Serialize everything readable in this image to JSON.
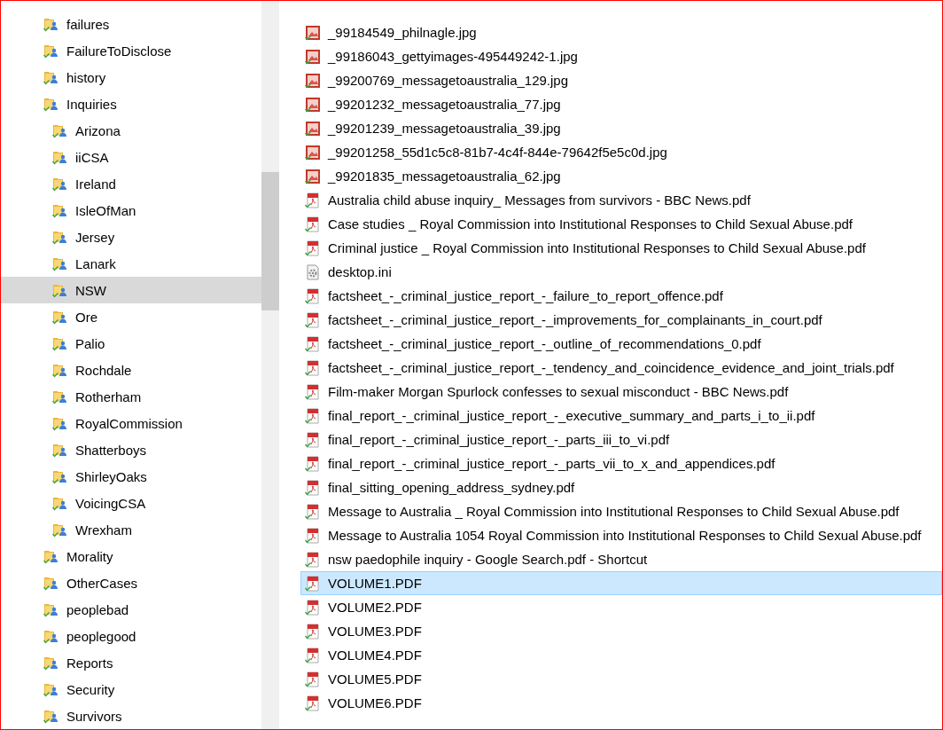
{
  "navigation_tree": {
    "items": [
      {
        "label": "failures",
        "selected": false
      },
      {
        "label": "FailureToDisclose",
        "selected": false
      },
      {
        "label": "history",
        "selected": false
      },
      {
        "label": "Inquiries",
        "selected": false,
        "children": [
          {
            "label": "Arizona",
            "selected": false
          },
          {
            "label": "iiCSA",
            "selected": false
          },
          {
            "label": "Ireland",
            "selected": false
          },
          {
            "label": "IsleOfMan",
            "selected": false
          },
          {
            "label": "Jersey",
            "selected": false
          },
          {
            "label": "Lanark",
            "selected": false
          },
          {
            "label": "NSW",
            "selected": true
          },
          {
            "label": "Ore",
            "selected": false
          },
          {
            "label": "Palio",
            "selected": false
          },
          {
            "label": "Rochdale",
            "selected": false
          },
          {
            "label": "Rotherham",
            "selected": false
          },
          {
            "label": "RoyalCommission",
            "selected": false
          },
          {
            "label": "Shatterboys",
            "selected": false
          },
          {
            "label": "ShirleyOaks",
            "selected": false
          },
          {
            "label": "VoicingCSA",
            "selected": false
          },
          {
            "label": "Wrexham",
            "selected": false
          }
        ]
      },
      {
        "label": "Morality",
        "selected": false
      },
      {
        "label": "OtherCases",
        "selected": false
      },
      {
        "label": "peoplebad",
        "selected": false
      },
      {
        "label": "peoplegood",
        "selected": false
      },
      {
        "label": "Reports",
        "selected": false
      },
      {
        "label": "Security",
        "selected": false
      },
      {
        "label": "Survivors",
        "selected": false
      }
    ]
  },
  "file_list": {
    "files": [
      {
        "name": "_99184549_philnagle.jpg",
        "kind": "image",
        "selected": false
      },
      {
        "name": "_99186043_gettyimages-495449242-1.jpg",
        "kind": "image",
        "selected": false
      },
      {
        "name": "_99200769_messagetoaustralia_129.jpg",
        "kind": "image",
        "selected": false
      },
      {
        "name": "_99201232_messagetoaustralia_77.jpg",
        "kind": "image",
        "selected": false
      },
      {
        "name": "_99201239_messagetoaustralia_39.jpg",
        "kind": "image",
        "selected": false
      },
      {
        "name": "_99201258_55d1c5c8-81b7-4c4f-844e-79642f5e5c0d.jpg",
        "kind": "image",
        "selected": false
      },
      {
        "name": "_99201835_messagetoaustralia_62.jpg",
        "kind": "image",
        "selected": false
      },
      {
        "name": "Australia child abuse inquiry_ Messages from survivors - BBC News.pdf",
        "kind": "pdf",
        "selected": false
      },
      {
        "name": "Case studies _ Royal Commission into Institutional Responses to Child Sexual Abuse.pdf",
        "kind": "pdf",
        "selected": false
      },
      {
        "name": "Criminal justice _ Royal Commission into Institutional Responses to Child Sexual Abuse.pdf",
        "kind": "pdf",
        "selected": false
      },
      {
        "name": "desktop.ini",
        "kind": "settings",
        "selected": false
      },
      {
        "name": "factsheet_-_criminal_justice_report_-_failure_to_report_offence.pdf",
        "kind": "pdf",
        "selected": false
      },
      {
        "name": "factsheet_-_criminal_justice_report_-_improvements_for_complainants_in_court.pdf",
        "kind": "pdf",
        "selected": false
      },
      {
        "name": "factsheet_-_criminal_justice_report_-_outline_of_recommendations_0.pdf",
        "kind": "pdf",
        "selected": false
      },
      {
        "name": "factsheet_-_criminal_justice_report_-_tendency_and_coincidence_evidence_and_joint_trials.pdf",
        "kind": "pdf",
        "selected": false
      },
      {
        "name": "Film-maker Morgan Spurlock confesses to sexual misconduct - BBC News.pdf",
        "kind": "pdf",
        "selected": false
      },
      {
        "name": "final_report_-_criminal_justice_report_-_executive_summary_and_parts_i_to_ii.pdf",
        "kind": "pdf",
        "selected": false
      },
      {
        "name": "final_report_-_criminal_justice_report_-_parts_iii_to_vi.pdf",
        "kind": "pdf",
        "selected": false
      },
      {
        "name": "final_report_-_criminal_justice_report_-_parts_vii_to_x_and_appendices.pdf",
        "kind": "pdf",
        "selected": false
      },
      {
        "name": "final_sitting_opening_address_sydney.pdf",
        "kind": "pdf",
        "selected": false
      },
      {
        "name": "Message to Australia _ Royal Commission into Institutional Responses to Child Sexual Abuse.pdf",
        "kind": "pdf",
        "selected": false
      },
      {
        "name": "Message to Australia 1054 Royal Commission into Institutional Responses to Child Sexual Abuse.pdf",
        "kind": "pdf",
        "selected": false
      },
      {
        "name": "nsw paedophile inquiry - Google Search.pdf - Shortcut",
        "kind": "pdf",
        "selected": false
      },
      {
        "name": "VOLUME1.PDF",
        "kind": "pdf",
        "selected": true
      },
      {
        "name": "VOLUME2.PDF",
        "kind": "pdf",
        "selected": false
      },
      {
        "name": "VOLUME3.PDF",
        "kind": "pdf",
        "selected": false
      },
      {
        "name": "VOLUME4.PDF",
        "kind": "pdf",
        "selected": false
      },
      {
        "name": "VOLUME5.PDF",
        "kind": "pdf",
        "selected": false
      },
      {
        "name": "VOLUME6.PDF",
        "kind": "pdf",
        "selected": false
      }
    ]
  }
}
